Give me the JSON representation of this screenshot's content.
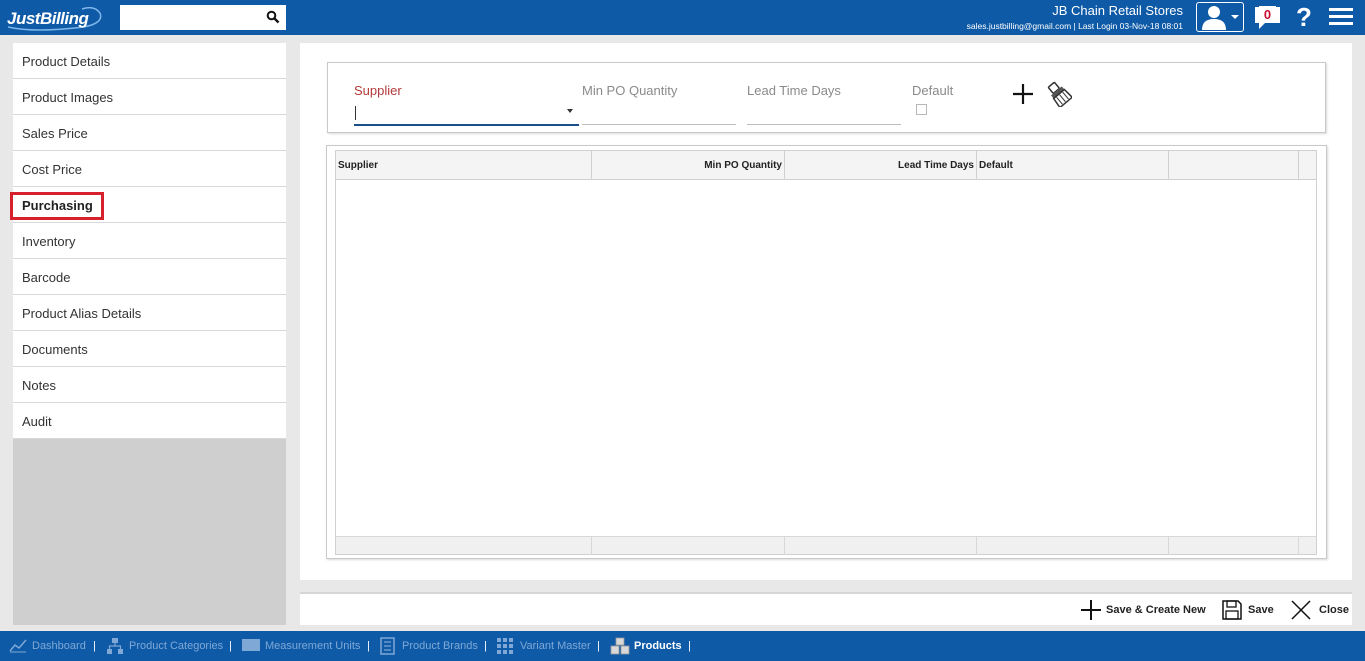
{
  "app": {
    "logo_text": "JustBilling"
  },
  "header": {
    "company": "JB Chain Retail Stores",
    "subline": "sales.justbilling@gmail.com | Last Login 03-Nov-18 08:01",
    "notification_count": "0",
    "help_label": "?",
    "search": {
      "value": "",
      "placeholder": ""
    }
  },
  "sidebar": {
    "items": [
      {
        "label": "Product Details"
      },
      {
        "label": "Product Images"
      },
      {
        "label": "Sales Price"
      },
      {
        "label": "Cost Price"
      },
      {
        "label": "Purchasing"
      },
      {
        "label": "Inventory"
      },
      {
        "label": "Barcode"
      },
      {
        "label": "Product Alias Details"
      },
      {
        "label": "Documents"
      },
      {
        "label": "Notes"
      },
      {
        "label": "Audit"
      }
    ],
    "active_index": 4
  },
  "form": {
    "supplier_label": "Supplier",
    "supplier_value": "",
    "min_po_label": "Min PO Quantity",
    "min_po_value": "",
    "lead_time_label": "Lead Time Days",
    "lead_time_value": "",
    "default_label": "Default",
    "default_checked": false
  },
  "grid": {
    "columns": [
      "Supplier",
      "Min PO Quantity",
      "Lead Time Days",
      "Default",
      ""
    ],
    "rows": []
  },
  "actions": {
    "save_create_new": "Save & Create New",
    "save": "Save",
    "close": "Close"
  },
  "taskbar": {
    "items": [
      {
        "label": "Dashboard"
      },
      {
        "label": "Product Categories"
      },
      {
        "label": "Measurement Units"
      },
      {
        "label": "Product Brands"
      },
      {
        "label": "Variant Master"
      },
      {
        "label": "Products"
      }
    ],
    "active_index": 5
  },
  "colors": {
    "brand_blue": "#0e5aa7",
    "required_red": "#b33a3a",
    "highlight_red": "#d6202c"
  }
}
